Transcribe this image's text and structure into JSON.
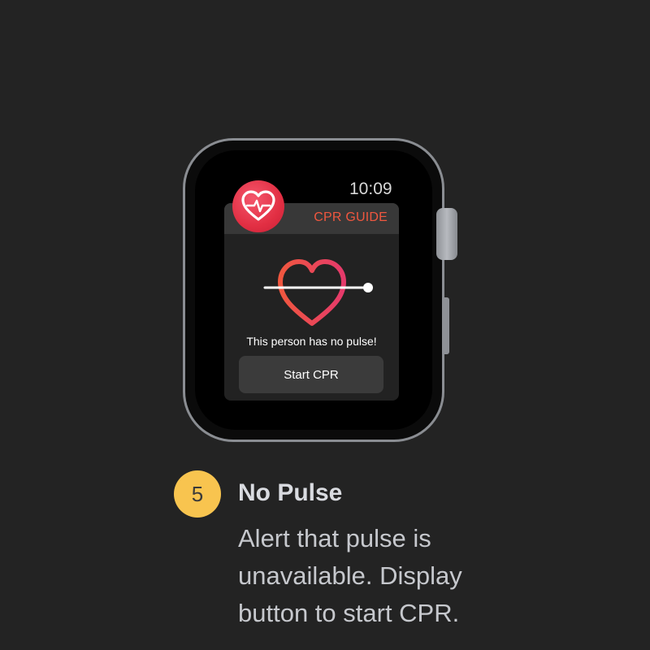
{
  "watch": {
    "time": "10:09",
    "notification": {
      "app_title": "CPR GUIDE",
      "message": "This person has no pulse!",
      "action_label": "Start CPR"
    }
  },
  "caption": {
    "step_number": "5",
    "title": "No Pulse",
    "description": "Alert that pulse is unavailable. Display button to start CPR."
  },
  "colors": {
    "background": "#232323",
    "accent_red": "#f0573f",
    "heart_gradient_start": "#f0573f",
    "heart_gradient_end": "#e53a6b",
    "badge_yellow": "#f8c44f"
  },
  "icons": {
    "app_icon": "heart-pulse-icon",
    "hero": "heart-slider-icon"
  }
}
